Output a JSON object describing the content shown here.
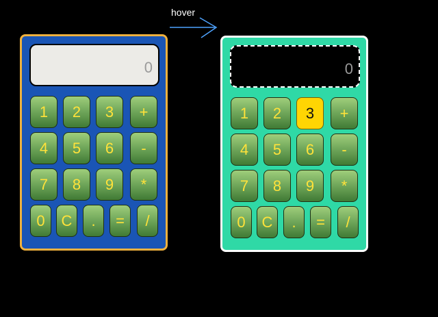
{
  "annotation": {
    "hover_label": "hover"
  },
  "display_value": "0",
  "keys": {
    "k1": "1",
    "k2": "2",
    "k3": "3",
    "plus": "+",
    "k4": "4",
    "k5": "5",
    "k6": "6",
    "minus": "-",
    "k7": "7",
    "k8": "8",
    "k9": "9",
    "times": "*",
    "k0": "0",
    "clear": "C",
    "dot": ".",
    "equals": "=",
    "divide": "/"
  },
  "colors": {
    "calc_normal_bg": "#1a55b5",
    "calc_normal_border": "#f0b13d",
    "calc_hover_bg": "#2fd9a6",
    "calc_hover_border": "#ffffff",
    "key_text": "#ffe23a",
    "key_highlight": "#ffd503"
  },
  "hover_state": {
    "highlighted_key": "3"
  }
}
